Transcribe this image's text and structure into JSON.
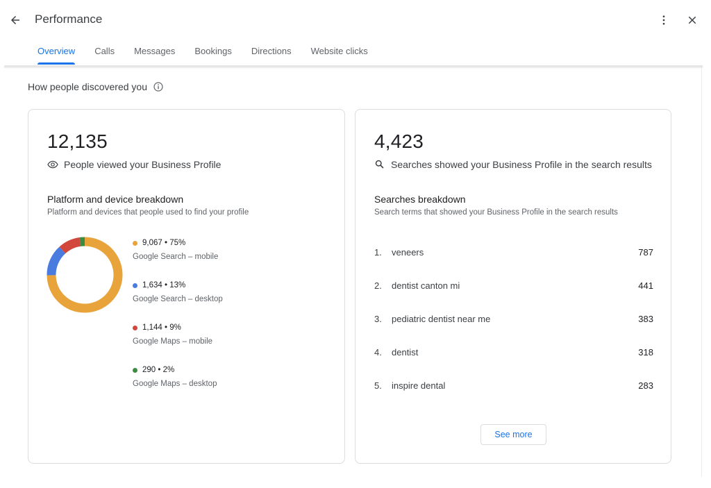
{
  "header": {
    "title": "Performance"
  },
  "tabs": [
    {
      "label": "Overview",
      "active": true
    },
    {
      "label": "Calls"
    },
    {
      "label": "Messages"
    },
    {
      "label": "Bookings"
    },
    {
      "label": "Directions"
    },
    {
      "label": "Website clicks"
    }
  ],
  "section": {
    "heading": "How people discovered you"
  },
  "views_card": {
    "total": "12,135",
    "caption": "People viewed your Business Profile",
    "breakdown_title": "Platform and device breakdown",
    "breakdown_desc": "Platform and devices that people used to find your profile",
    "segments": [
      {
        "value_label": "9,067 • 75%",
        "label": "Google Search – mobile",
        "value": 9067,
        "color": "#e8a33a"
      },
      {
        "value_label": "1,634 • 13%",
        "label": "Google Search – desktop",
        "value": 1634,
        "color": "#4a7bde"
      },
      {
        "value_label": "1,144 • 9%",
        "label": "Google Maps – mobile",
        "value": 1144,
        "color": "#d2473b"
      },
      {
        "value_label": "290 • 2%",
        "label": "Google Maps – desktop",
        "value": 290,
        "color": "#3c8b43"
      }
    ]
  },
  "searches_card": {
    "total": "4,423",
    "caption": "Searches showed your Business Profile in the search results",
    "breakdown_title": "Searches breakdown",
    "breakdown_desc": "Search terms that showed your Business Profile in the search results",
    "rows": [
      {
        "rank": "1.",
        "term": "veneers",
        "count": "787"
      },
      {
        "rank": "2.",
        "term": "dentist canton mi",
        "count": "441"
      },
      {
        "rank": "3.",
        "term": "pediatric dentist near me",
        "count": "383"
      },
      {
        "rank": "4.",
        "term": "dentist",
        "count": "318"
      },
      {
        "rank": "5.",
        "term": "inspire dental",
        "count": "283"
      }
    ],
    "see_more_label": "See more"
  },
  "icons": {
    "back": "arrow-back-icon",
    "more": "more-vert-icon",
    "close": "close-icon",
    "info": "info-icon",
    "views": "eye-icon",
    "searches": "search-icon"
  }
}
